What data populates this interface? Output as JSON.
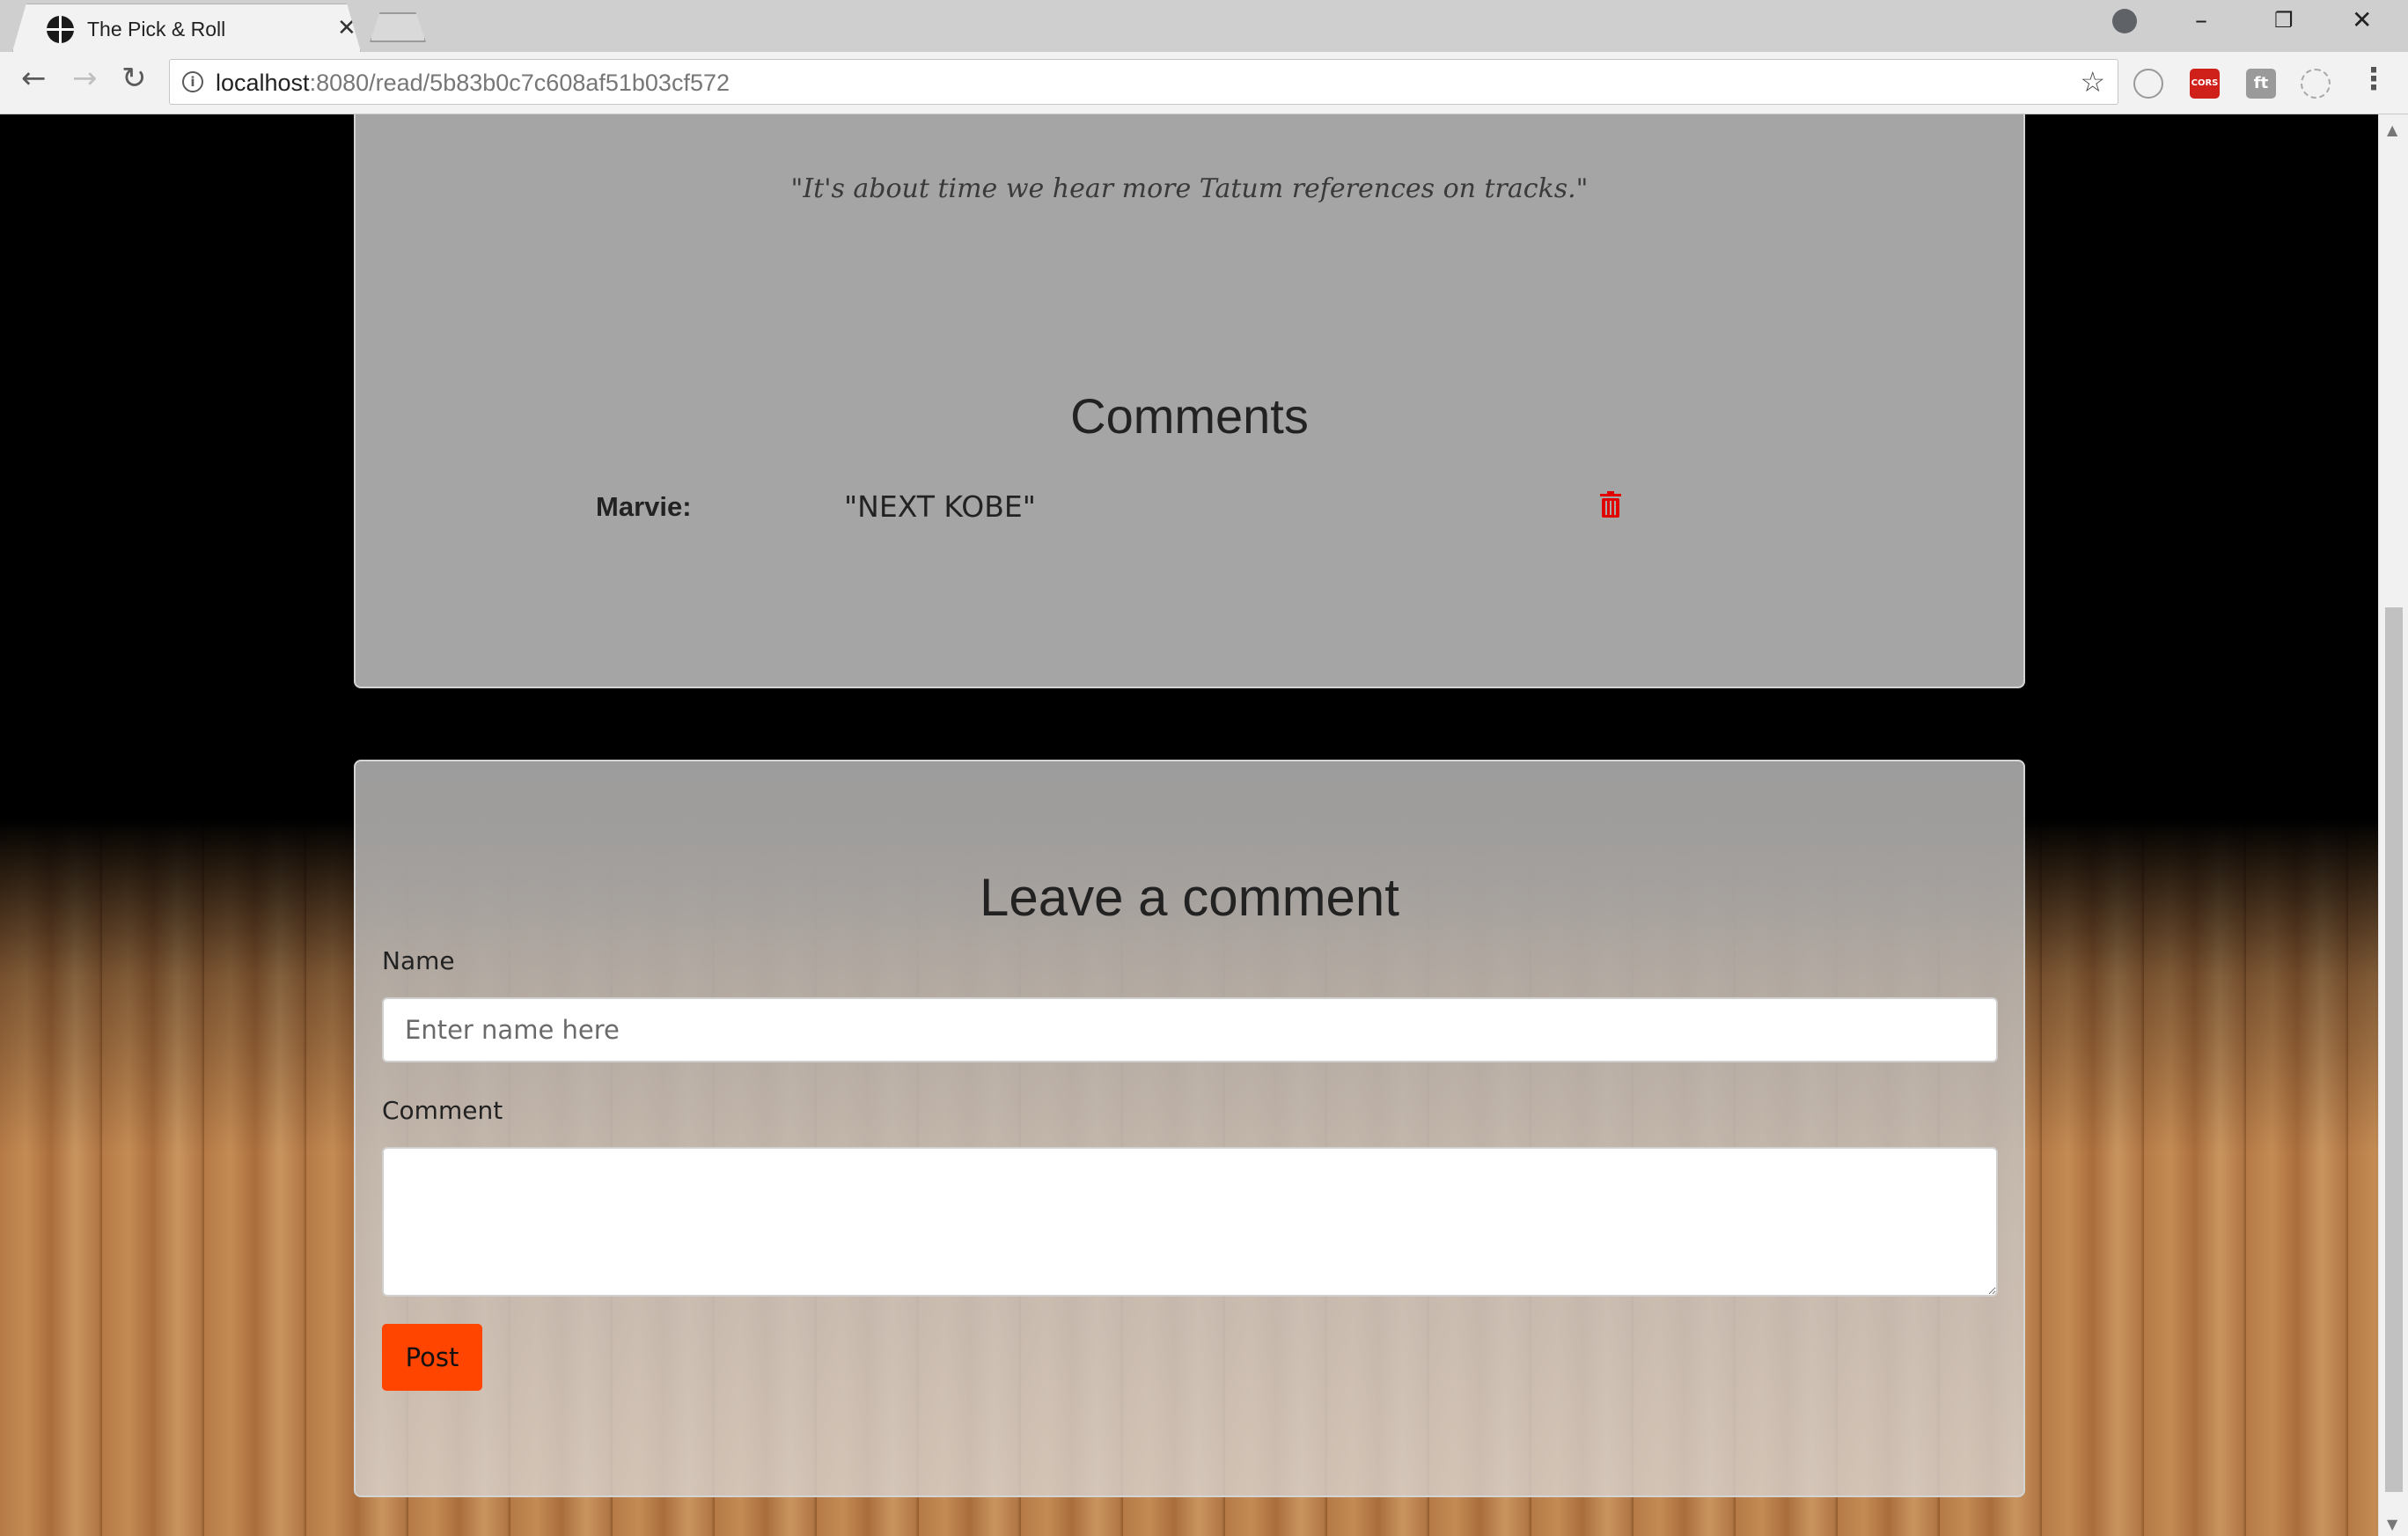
{
  "browser": {
    "tab_title": "The Pick & Roll",
    "url_host": "localhost",
    "url_path": ":8080/read/5b83b0c7c608af51b03cf572",
    "extensions": [
      "CORS",
      "ft"
    ]
  },
  "article": {
    "quote": "\"It's about time we hear more Tatum references on tracks.\""
  },
  "comments": {
    "heading": "Comments",
    "items": [
      {
        "author": "Marvie:",
        "text": "\"NEXT KOBE\""
      }
    ]
  },
  "comment_form": {
    "heading": "Leave a comment",
    "name_label": "Name",
    "name_placeholder": "Enter name here",
    "comment_label": "Comment",
    "comment_value": "",
    "submit_label": "Post"
  },
  "colors": {
    "accent": "#ff4500",
    "delete": "#e00000",
    "card": "#aaaaaa"
  }
}
